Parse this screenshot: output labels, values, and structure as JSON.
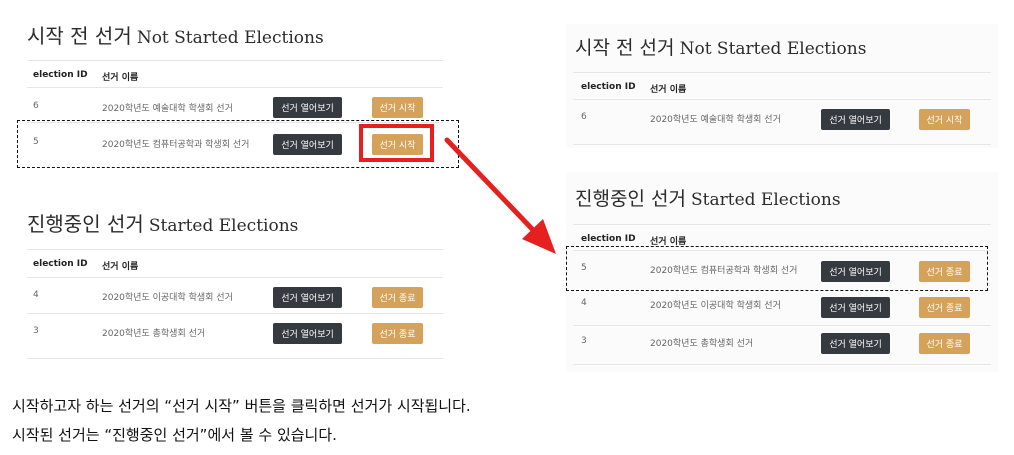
{
  "left": {
    "not_started": {
      "title_ko": "시작 전 선거",
      "title_en": "Not Started Elections",
      "col_id": "election ID",
      "col_name": "선거 이름",
      "rows": [
        {
          "id": "6",
          "name": "2020학년도 예술대학 학생회 선거",
          "view": "선거 열어보기",
          "action": "선거 시작"
        },
        {
          "id": "5",
          "name": "2020학년도 컴퓨터공학과 학생회 선거",
          "view": "선거 열어보기",
          "action": "선거 시작"
        }
      ]
    },
    "started": {
      "title_ko": "진행중인 선거",
      "title_en": "Started Elections",
      "col_id": "election ID",
      "col_name": "선거 이름",
      "rows": [
        {
          "id": "4",
          "name": "2020학년도 이공대학 학생회 선거",
          "view": "선거 열어보기",
          "action": "선거 종료"
        },
        {
          "id": "3",
          "name": "2020학년도 총학생회 선거",
          "view": "선거 열어보기",
          "action": "선거 종료"
        }
      ]
    }
  },
  "right": {
    "not_started": {
      "title_ko": "시작 전 선거",
      "title_en": "Not Started Elections",
      "col_id": "election ID",
      "col_name": "선거 이름",
      "rows": [
        {
          "id": "6",
          "name": "2020학년도 예술대학 학생회 선거",
          "view": "선거 열어보기",
          "action": "선거 시작"
        }
      ]
    },
    "started": {
      "title_ko": "진행중인 선거",
      "title_en": "Started Elections",
      "col_id": "election ID",
      "col_name": "선거 이름",
      "rows": [
        {
          "id": "5",
          "name": "2020학년도 컴퓨터공학과 학생회 선거",
          "view": "선거 열어보기",
          "action": "선거 종료"
        },
        {
          "id": "4",
          "name": "2020학년도 이공대학 학생회 선거",
          "view": "선거 열어보기",
          "action": "선거 종료"
        },
        {
          "id": "3",
          "name": "2020학년도 총학생회 선거",
          "view": "선거 열어보기",
          "action": "선거 종료"
        }
      ]
    }
  },
  "captions": {
    "line1": "시작하고자 하는 선거의 “선거 시작” 버튼을 클릭하면 선거가 시작됩니다.",
    "line2": "시작된 선거는 “진행중인 선거”에서 볼 수 있습니다."
  },
  "colors": {
    "dark_button": "#343a40",
    "orange_button": "#d4a25a",
    "highlight_red": "#e61f1f"
  }
}
